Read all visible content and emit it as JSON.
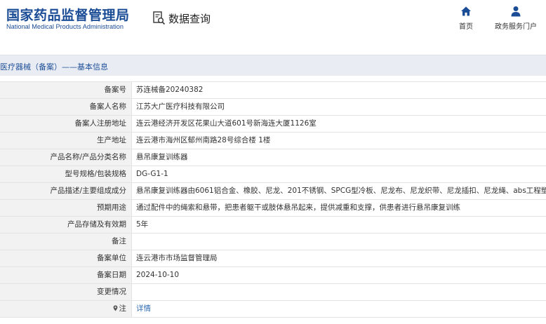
{
  "header": {
    "logo_cn": "国家药品监督管理局",
    "logo_en": "National Medical Products Administration",
    "query_label": "数据查询",
    "nav": [
      {
        "label": "首页",
        "icon": "home-icon"
      },
      {
        "label": "政务服务门户",
        "icon": "user-icon"
      }
    ]
  },
  "section_title": "医疗器械（备案）——基本信息",
  "colors": {
    "brand": "#1b4c96",
    "link": "#2f6db5",
    "label_bg": "#f2f2f2",
    "section_bg": "#e9edf3"
  },
  "rows": [
    {
      "label": "备案号",
      "value": "苏连械备20240382"
    },
    {
      "label": "备案人名称",
      "value": "江苏大广医疗科技有限公司"
    },
    {
      "label": "备案人注册地址",
      "value": "连云港经济开发区花果山大道601号新海连大厦1126室"
    },
    {
      "label": "生产地址",
      "value": "连云港市海州区郁州南路28号综合楼 1楼"
    },
    {
      "label": "产品名称/产品分类名称",
      "value": "悬吊康复训练器"
    },
    {
      "label": "型号规格/包装规格",
      "value": "DG-G1-1"
    },
    {
      "label": "产品描述/主要组成成分",
      "value": "悬吊康复训练器由6061铝合金、橡胶、尼龙、201不锈钢、SPCG型冷板、尼龙布、尼龙织带、尼龙插扣、尼龙绳、abs工程塑料制成"
    },
    {
      "label": "预期用途",
      "value": "通过配件中的绳索和悬带，把患者躯干或肢体悬吊起来，提供减重和支撑，供患者进行悬吊康复训练"
    },
    {
      "label": "产品存储及有效期",
      "value": "5年"
    },
    {
      "label": "备注",
      "value": ""
    },
    {
      "label": "备案单位",
      "value": "连云港市市场监督管理局"
    },
    {
      "label": "备案日期",
      "value": "2024-10-10"
    },
    {
      "label": "变更情况",
      "value": ""
    },
    {
      "label": "注",
      "value": "详情"
    }
  ]
}
